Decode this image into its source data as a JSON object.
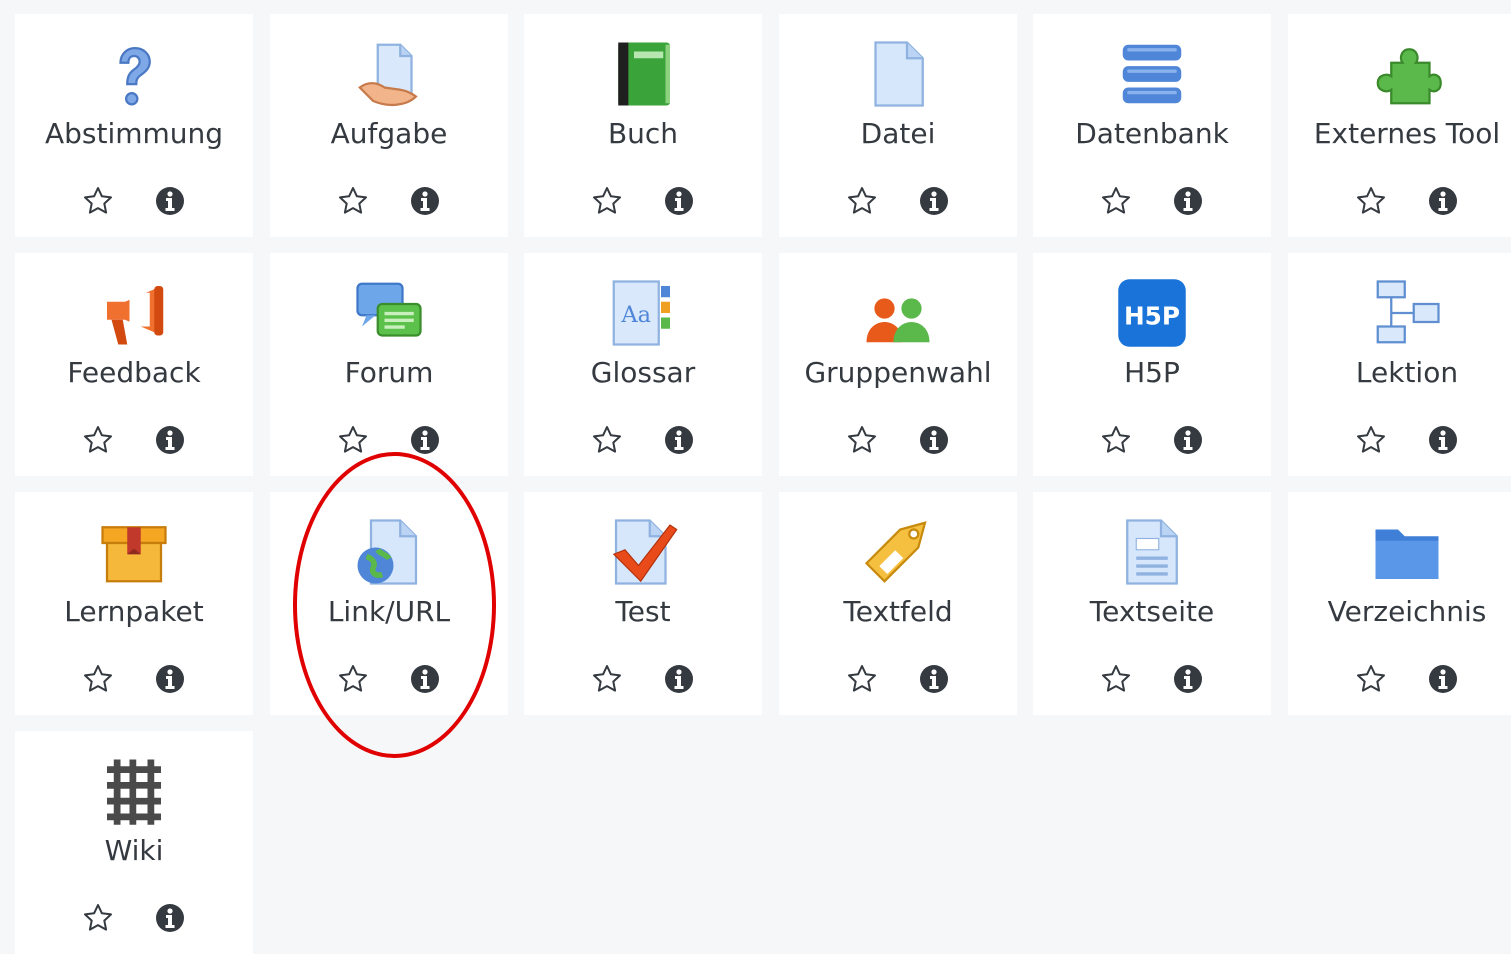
{
  "activities": [
    {
      "label": "Abstimmung",
      "icon": "choice-icon"
    },
    {
      "label": "Aufgabe",
      "icon": "assignment-icon"
    },
    {
      "label": "Buch",
      "icon": "book-icon"
    },
    {
      "label": "Datei",
      "icon": "file-icon"
    },
    {
      "label": "Datenbank",
      "icon": "database-icon"
    },
    {
      "label": "Externes Tool",
      "icon": "external-tool-icon"
    },
    {
      "label": "Feedback",
      "icon": "feedback-icon"
    },
    {
      "label": "Forum",
      "icon": "forum-icon"
    },
    {
      "label": "Glossar",
      "icon": "glossary-icon"
    },
    {
      "label": "Gruppenwahl",
      "icon": "group-choice-icon"
    },
    {
      "label": "H5P",
      "icon": "h5p-icon",
      "badge_text": "H5P"
    },
    {
      "label": "Lektion",
      "icon": "lesson-icon"
    },
    {
      "label": "Lernpaket",
      "icon": "package-icon"
    },
    {
      "label": "Link/URL",
      "icon": "url-icon"
    },
    {
      "label": "Test",
      "icon": "quiz-icon"
    },
    {
      "label": "Textfeld",
      "icon": "label-tag-icon"
    },
    {
      "label": "Textseite",
      "icon": "page-icon"
    },
    {
      "label": "Verzeichnis",
      "icon": "folder-icon"
    },
    {
      "label": "Wiki",
      "icon": "wiki-icon"
    }
  ],
  "actions": {
    "star_icon": "star-outline-icon",
    "info_icon": "info-icon"
  },
  "highlight": {
    "target": "Link/URL",
    "color": "#e00000"
  },
  "colors": {
    "background": "#f6f7f9",
    "card": "#ffffff",
    "text": "#343a40",
    "icon_dark": "#343a40"
  }
}
